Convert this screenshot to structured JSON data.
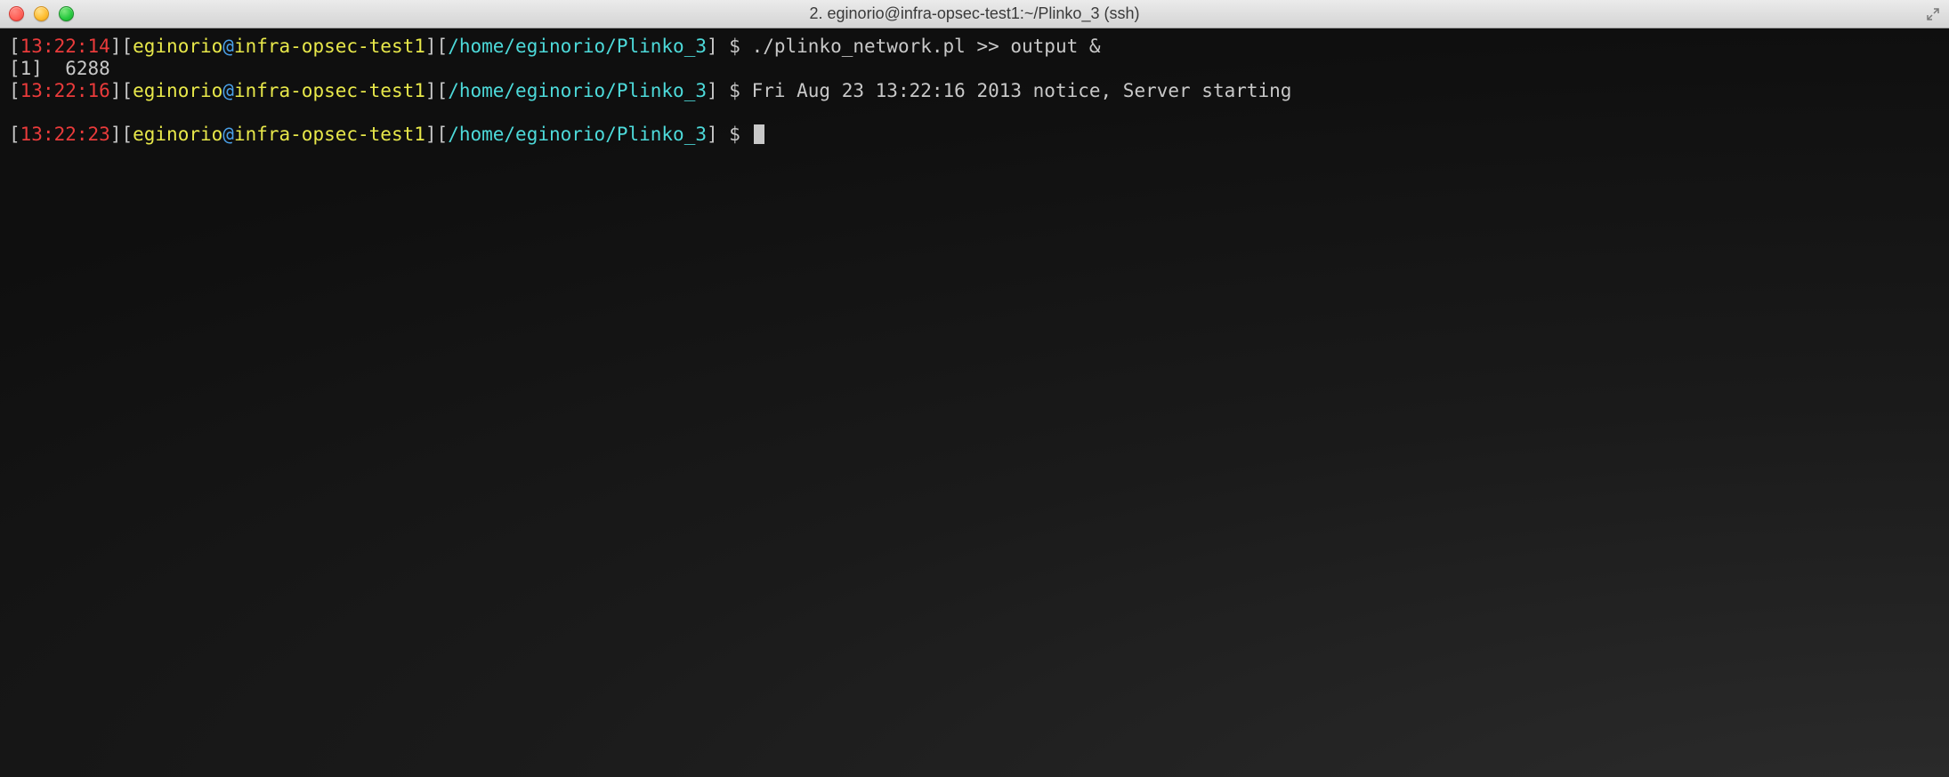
{
  "window": {
    "title": "2. eginorio@infra-opsec-test1:~/Plinko_3 (ssh)"
  },
  "colors": {
    "timestamp": "#ea3b3b",
    "user": "#e8e84a",
    "at": "#4aa0e8",
    "host": "#e8e84a",
    "path": "#4ddada",
    "text": "#c8c8c8",
    "bg": "#1a1a1a"
  },
  "lines": [
    {
      "type": "prompt",
      "timestamp": "13:22:14",
      "user": "eginorio",
      "at": "@",
      "host": "infra-opsec-test1",
      "path": "/home/eginorio/Plinko_3",
      "dollar": " $ ",
      "command": "./plinko_network.pl >> output &"
    },
    {
      "type": "output",
      "text": "[1]  6288"
    },
    {
      "type": "prompt",
      "timestamp": "13:22:16",
      "user": "eginorio",
      "at": "@",
      "host": "infra-opsec-test1",
      "path": "/home/eginorio/Plinko_3",
      "dollar": " $ ",
      "command": "Fri Aug 23 13:22:16 2013 notice, Server starting"
    },
    {
      "type": "blank"
    },
    {
      "type": "prompt",
      "timestamp": "13:22:23",
      "user": "eginorio",
      "at": "@",
      "host": "infra-opsec-test1",
      "path": "/home/eginorio/Plinko_3",
      "dollar": " $ ",
      "command": "",
      "cursor": true
    }
  ],
  "brackets": {
    "open": "[",
    "close": "]"
  }
}
